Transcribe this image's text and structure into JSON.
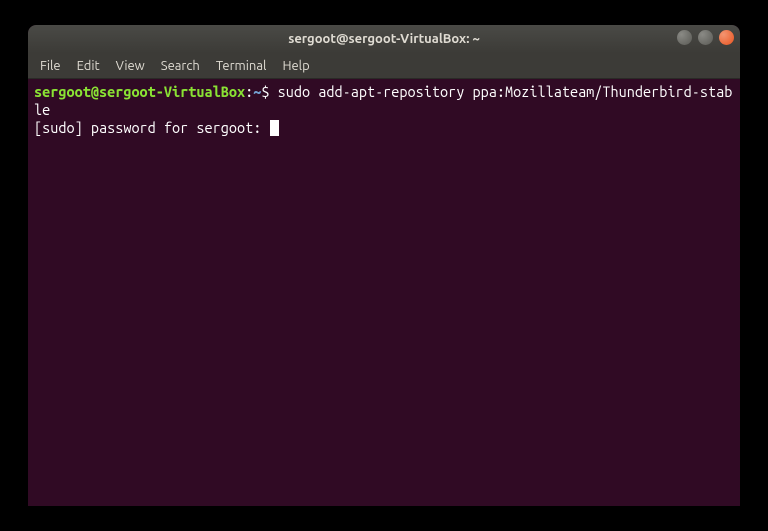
{
  "titlebar": {
    "title": "sergoot@sergoot-VirtualBox: ~"
  },
  "menubar": {
    "items": [
      "File",
      "Edit",
      "View",
      "Search",
      "Terminal",
      "Help"
    ]
  },
  "terminal": {
    "prompt_user": "sergoot@sergoot-VirtualBox",
    "prompt_colon": ":",
    "prompt_path": "~",
    "prompt_dollar": "$ ",
    "command": "sudo add-apt-repository ppa:Mozillateam/Thunderbird-stable",
    "output_line": "[sudo] password for sergoot: "
  }
}
